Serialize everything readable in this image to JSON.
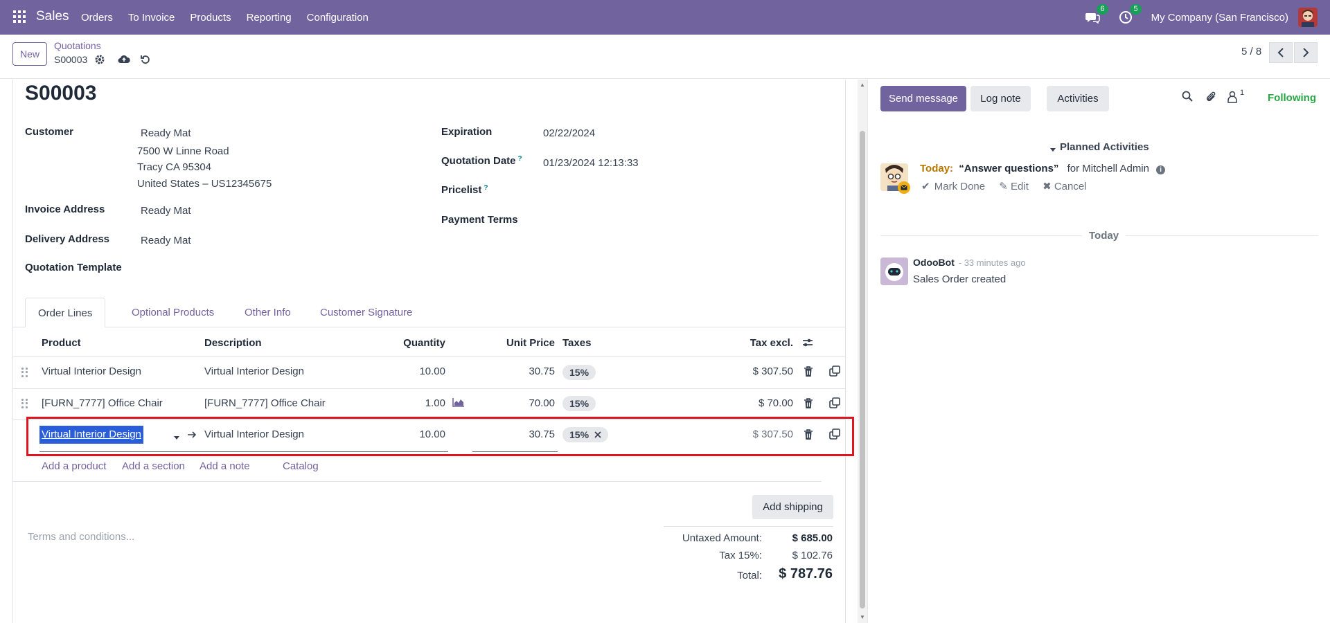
{
  "navbar": {
    "brand": "Sales",
    "menu": [
      "Orders",
      "To Invoice",
      "Products",
      "Reporting",
      "Configuration"
    ],
    "messages_badge": "6",
    "activities_badge": "5",
    "company": "My Company (San Francisco)",
    "bg_color": "#71639e"
  },
  "control": {
    "new_label": "New",
    "breadcrumb_parent": "Quotations",
    "breadcrumb_current": "S00003",
    "pager": "5 / 8"
  },
  "form": {
    "title": "S00003",
    "customer_label": "Customer",
    "customer_name": "Ready Mat",
    "customer_address": [
      "7500 W Linne Road",
      "Tracy CA 95304",
      "United States – US12345675"
    ],
    "invoice_address_label": "Invoice Address",
    "invoice_address": "Ready Mat",
    "delivery_address_label": "Delivery Address",
    "delivery_address": "Ready Mat",
    "template_label": "Quotation Template",
    "expiration_label": "Expiration",
    "expiration": "02/22/2024",
    "quotation_date_label": "Quotation Date",
    "quotation_date": "01/23/2024 12:13:33",
    "help_mark": "?",
    "pricelist_label": "Pricelist",
    "payment_terms_label": "Payment Terms"
  },
  "tabs": [
    "Order Lines",
    "Optional Products",
    "Other Info",
    "Customer Signature"
  ],
  "table": {
    "headers": {
      "product": "Product",
      "description": "Description",
      "quantity": "Quantity",
      "unit_price": "Unit Price",
      "taxes": "Taxes",
      "tax_excl": "Tax excl."
    },
    "rows": [
      {
        "product": "Virtual Interior Design",
        "description": "Virtual Interior Design",
        "quantity": "10.00",
        "unit_price": "30.75",
        "tax": "15%",
        "subtotal": "$ 307.50"
      },
      {
        "product": "[FURN_7777] Office Chair",
        "description": "[FURN_7777] Office Chair",
        "quantity": "1.00",
        "unit_price": "70.00",
        "tax": "15%",
        "subtotal": "$ 70.00"
      },
      {
        "product": "Virtual Interior Design",
        "description": "Virtual Interior Design",
        "quantity": "10.00",
        "unit_price": "30.75",
        "tax": "15%",
        "subtotal": "$ 307.50"
      }
    ],
    "add_links": [
      "Add a product",
      "Add a section",
      "Add a note",
      "Catalog"
    ]
  },
  "footer": {
    "add_shipping": "Add shipping",
    "terms_placeholder": "Terms and conditions...",
    "untaxed_label": "Untaxed Amount:",
    "untaxed_value": "$ 685.00",
    "tax_label": "Tax 15%:",
    "tax_value": "$ 102.76",
    "total_label": "Total:",
    "total_value": "$ 787.76"
  },
  "chatter": {
    "send_message": "Send message",
    "log_note": "Log note",
    "activities": "Activities",
    "followers_count": "1",
    "following": "Following",
    "planned_activities": "Planned Activities",
    "activity_when": "Today:",
    "activity_summary": "“Answer questions”",
    "activity_for": "for Mitchell Admin",
    "mark_done": "Mark Done",
    "edit": "Edit",
    "cancel": "Cancel",
    "today_separator": "Today",
    "message_author": "OdooBot",
    "message_time": "- 33 minutes ago",
    "message_body": "Sales Order created"
  }
}
